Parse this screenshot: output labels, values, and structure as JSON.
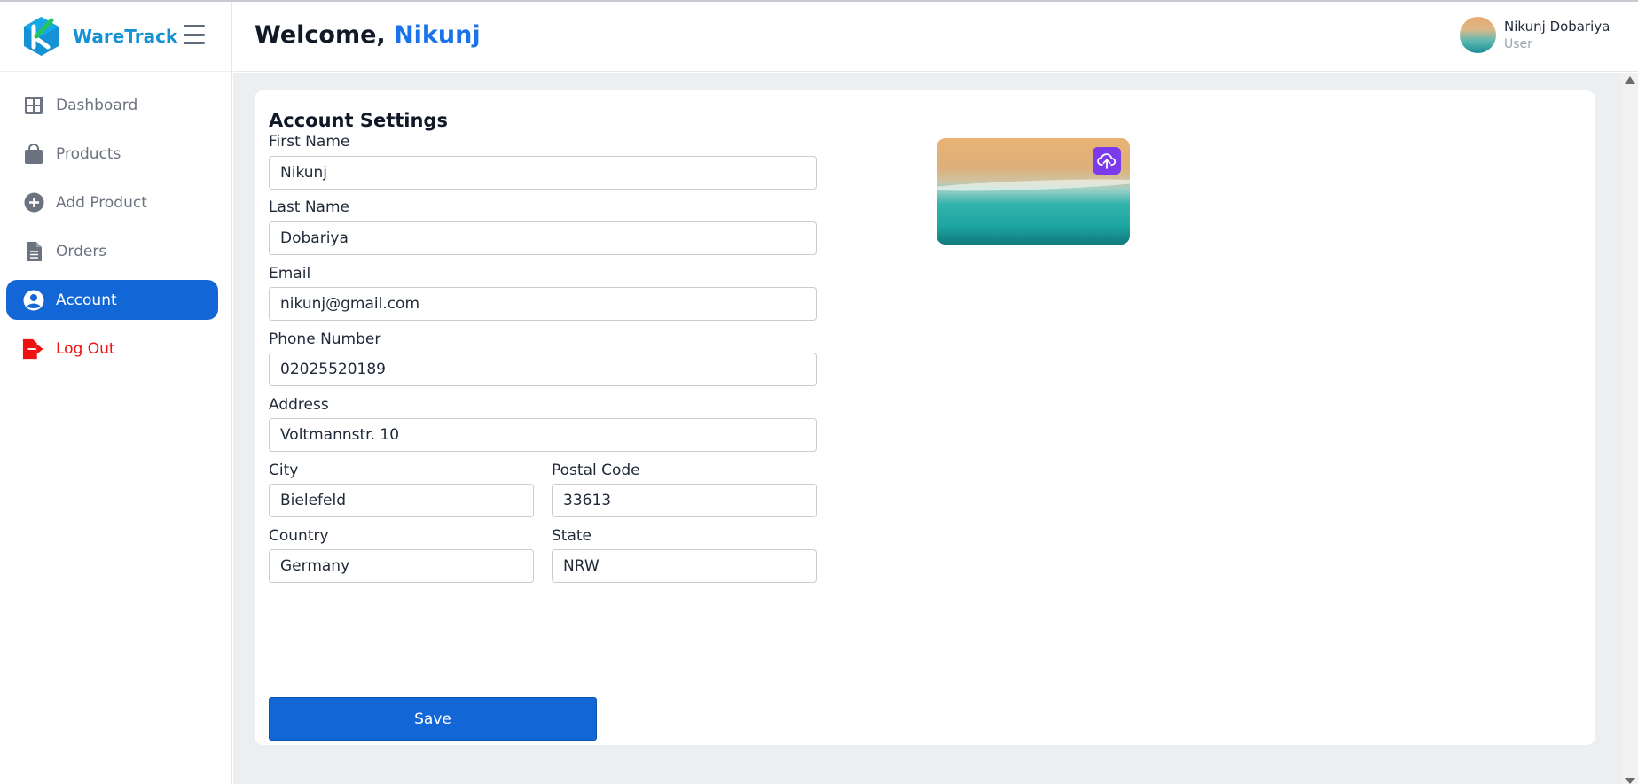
{
  "brand": {
    "name": "WareTrack"
  },
  "sidebar": {
    "items": [
      {
        "label": "Dashboard"
      },
      {
        "label": "Products"
      },
      {
        "label": "Add Product"
      },
      {
        "label": "Orders"
      },
      {
        "label": "Account"
      },
      {
        "label": "Log Out"
      }
    ],
    "active_item": "Account"
  },
  "header": {
    "welcome_prefix": "Welcome,",
    "welcome_name": "Nikunj",
    "user": {
      "name": "Nikunj Dobariya",
      "role": "User"
    }
  },
  "account": {
    "title": "Account Settings",
    "fields": {
      "first_name": {
        "label": "First Name",
        "value": "Nikunj"
      },
      "last_name": {
        "label": "Last Name",
        "value": "Dobariya"
      },
      "email": {
        "label": "Email",
        "value": "nikunj@gmail.com"
      },
      "phone": {
        "label": "Phone Number",
        "value": "02025520189"
      },
      "address": {
        "label": "Address",
        "value": "Voltmannstr. 10"
      },
      "city": {
        "label": "City",
        "value": "Bielefeld"
      },
      "postal_code": {
        "label": "Postal Code",
        "value": "33613"
      },
      "country": {
        "label": "Country",
        "value": "Germany"
      },
      "state": {
        "label": "State",
        "value": "NRW"
      }
    },
    "save_label": "Save"
  },
  "colors": {
    "primary": "#1366d6",
    "brand_text": "#1592d6",
    "logout": "#ef1111",
    "upload_button": "#7c3aed",
    "background": "#eceff2"
  },
  "icons": {
    "dashboard": "grid-icon",
    "products": "shopping-bag-icon",
    "add_product": "plus-circle-icon",
    "orders": "document-icon",
    "account": "user-circle-icon",
    "logout": "logout-icon",
    "upload": "cloud-upload-icon",
    "menu": "hamburger-icon"
  }
}
